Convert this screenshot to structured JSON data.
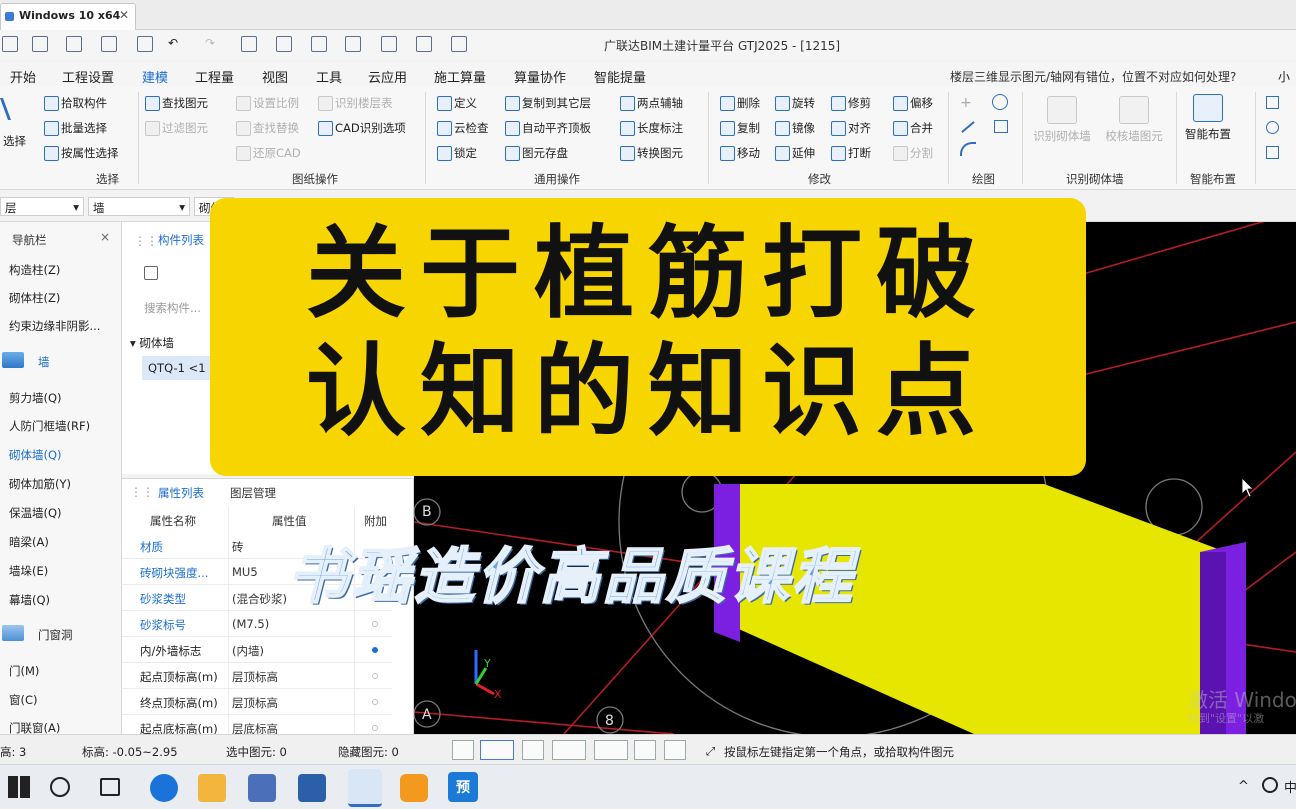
{
  "vm_tab": {
    "title": "Windows 10 x64",
    "close": "✕"
  },
  "app_title": "广联达BIM土建计量平台 GTJ2025 - [1215]",
  "menu": [
    "开始",
    "工程设置",
    "建模",
    "工程量",
    "视图",
    "工具",
    "云应用",
    "施工算量",
    "算量协作",
    "智能提量"
  ],
  "help_question": "楼层三维显示图元/轴网有错位，位置不对应如何处理?",
  "help_right": "小",
  "ribbon": {
    "select_group": {
      "big": "选择",
      "items": [
        "拾取构件",
        "批量选择",
        "按属性选择"
      ],
      "label": "选择"
    },
    "drawing_group": {
      "items": [
        "查找图元",
        "过滤图元",
        "设置比例",
        "查找替换",
        "还原CAD",
        "识别楼层表",
        "CAD识别选项"
      ],
      "label": "图纸操作"
    },
    "general_group": {
      "items": [
        "定义",
        "云检查",
        "锁定",
        "复制到其它层",
        "自动平齐顶板",
        "图元存盘",
        "两点辅轴",
        "长度标注",
        "转换图元"
      ],
      "label": "通用操作"
    },
    "modify_group": {
      "items": [
        "删除",
        "复制",
        "移动",
        "旋转",
        "镜像",
        "延伸",
        "修剪",
        "对齐",
        "打断",
        "偏移",
        "合并",
        "分割"
      ],
      "label": "修改"
    },
    "draw_group": {
      "label": "绘图"
    },
    "recognize_group": {
      "items": [
        "识别砌体墙",
        "校核墙图元"
      ],
      "label": "识别砌体墙"
    },
    "smart_group": {
      "items": [
        "智能布置"
      ],
      "label": "智能布置"
    }
  },
  "selectors": [
    "层",
    "墙",
    "砌体"
  ],
  "nav": {
    "title": "导航栏",
    "items_top": [
      "构造柱(Z)",
      "砌体柱(Z)",
      "约束边缘非阴影..."
    ],
    "wall_head": "墙",
    "wall_items": [
      "剪力墙(Q)",
      "人防门框墙(RF)",
      "砌体墙(Q)",
      "砌体加筋(Y)",
      "保温墙(Q)",
      "暗梁(A)",
      "墙垛(E)",
      "幕墙(Q)"
    ],
    "door_head": "门窗洞",
    "door_items": [
      "门(M)",
      "窗(C)",
      "门联窗(A)"
    ]
  },
  "component_list": {
    "tab": "构件列表",
    "search_placeholder": "搜索构件...",
    "tree_head": "砌体墙",
    "selected_item": "QTQ-1 <1"
  },
  "properties": {
    "tabs": [
      "属性列表",
      "图层管理"
    ],
    "headers": [
      "属性名称",
      "属性值",
      "附加"
    ],
    "rows": [
      {
        "name": "材质",
        "value": "砖",
        "dot": false,
        "blue": true
      },
      {
        "name": "砖砌块强度...",
        "value": "MU5",
        "dot": true,
        "blue": true
      },
      {
        "name": "砂浆类型",
        "value": "(混合砂浆)",
        "dot": true,
        "blue": true
      },
      {
        "name": "砂浆标号",
        "value": "(M7.5)",
        "dot": true,
        "blue": true
      },
      {
        "name": "内/外墙标志",
        "value": "(内墙)",
        "dot": true,
        "on": true,
        "blue": false
      },
      {
        "name": "起点顶标高(m)",
        "value": "层顶标高",
        "dot": true,
        "blue": false
      },
      {
        "name": "终点顶标高(m)",
        "value": "层顶标高",
        "dot": true,
        "blue": false
      },
      {
        "name": "起点底标高(m)",
        "value": "层底标高",
        "dot": true,
        "blue": false
      }
    ]
  },
  "viewport": {
    "axis_labels": {
      "b": "B",
      "a": "A",
      "n8": "8"
    },
    "triad": {
      "y": "Y",
      "x": "X"
    }
  },
  "status": {
    "floor": "高: 3",
    "elev": "标高: -0.05~2.95",
    "selected": "选中图元: 0",
    "hidden": "隐藏图元: 0",
    "hint": "按鼠标左键指定第一个角点，或拾取构件图元"
  },
  "overlay": {
    "line1": "关于植筋打破",
    "line2": "认知的知识点",
    "subtitle": "书瑶造价高品质课程"
  },
  "watermark": {
    "line1": "激活 Windo",
    "line2": "转到\"设置\"以激"
  },
  "taskbar": {
    "preview_label": "预"
  },
  "colors": {
    "accent": "#1b6dd1",
    "banner": "#f7d500",
    "wall_yellow": "#e6e600",
    "column_purple": "#7b1fe0",
    "grid_red": "#c0202a"
  }
}
